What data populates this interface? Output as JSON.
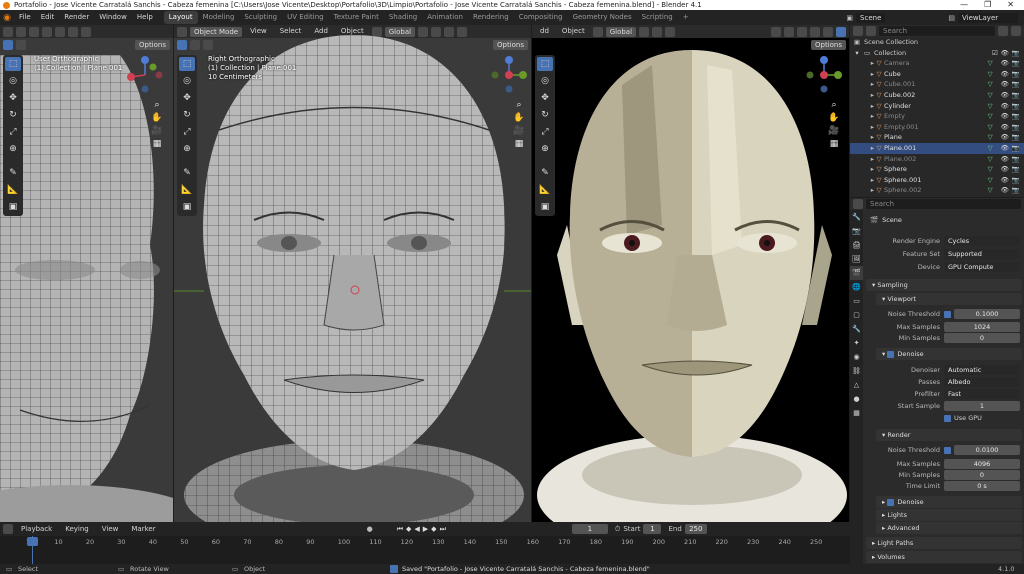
{
  "window": {
    "title": "Portafolio - Jose Vicente Carratalá Sanchis - Cabeza femenina [C:\\Users\\Jose Vicente\\Desktop\\Portafolio\\3D\\Limpio\\Portafolio - Jose Vicente Carratalá Sanchis - Cabeza femenina.blend] - Blender 4.1",
    "controls": [
      "—",
      "❐",
      "✕"
    ]
  },
  "menu": [
    "File",
    "Edit",
    "Render",
    "Window",
    "Help"
  ],
  "workspaces": [
    "Layout",
    "Modeling",
    "Sculpting",
    "UV Editing",
    "Texture Paint",
    "Shading",
    "Animation",
    "Rendering",
    "Compositing",
    "Geometry Nodes",
    "Scripting",
    "+"
  ],
  "scene_name": "Scene",
  "view_layer": "ViewLayer",
  "viewport_left": {
    "options": "Options",
    "view_name": "User Orthographic",
    "collection": "(1) Collection | Plane.001"
  },
  "viewport_mid": {
    "mode": "Object Mode",
    "menus": [
      "View",
      "Select",
      "Add",
      "Object"
    ],
    "transform": "Global",
    "options": "Options",
    "view_name": "Right Orthographic",
    "collection": "(1) Collection | Plane.001",
    "scale": "10 Centimeters"
  },
  "viewport_right": {
    "menus": [
      "dd",
      "Object"
    ],
    "transform": "Global",
    "options": "Options"
  },
  "outliner": {
    "search_placeholder": "Search",
    "root": "Scene Collection",
    "collection": "Collection",
    "items": [
      {
        "name": "Camera",
        "dim": true
      },
      {
        "name": "Cube",
        "dim": false
      },
      {
        "name": "Cube.001",
        "dim": true
      },
      {
        "name": "Cube.002",
        "dim": false
      },
      {
        "name": "Cylinder",
        "dim": false
      },
      {
        "name": "Empty",
        "dim": true
      },
      {
        "name": "Empty.001",
        "dim": true
      },
      {
        "name": "Plane",
        "dim": false
      },
      {
        "name": "Plane.001",
        "dim": false,
        "selected": true
      },
      {
        "name": "Plane.002",
        "dim": true
      },
      {
        "name": "Sphere",
        "dim": false
      },
      {
        "name": "Sphere.001",
        "dim": false
      },
      {
        "name": "Sphere.002",
        "dim": true
      }
    ]
  },
  "properties": {
    "search_placeholder": "Search",
    "context": "Scene",
    "render_engine_label": "Render Engine",
    "render_engine": "Cycles",
    "feature_set_label": "Feature Set",
    "feature_set": "Supported",
    "device_label": "Device",
    "device": "GPU Compute",
    "sampling": "Sampling",
    "viewport": "Viewport",
    "vp_noise_label": "Noise Threshold",
    "vp_noise": "0.1000",
    "vp_max_label": "Max Samples",
    "vp_max": "1024",
    "vp_min_label": "Min Samples",
    "vp_min": "0",
    "denoise": "Denoise",
    "denoiser_label": "Denoiser",
    "denoiser": "Automatic",
    "passes_label": "Passes",
    "passes": "Albedo",
    "prefilter_label": "Prefilter",
    "prefilter": "Fast",
    "start_sample_label": "Start Sample",
    "start_sample": "1",
    "use_gpu": "Use GPU",
    "render": "Render",
    "r_noise_label": "Noise Threshold",
    "r_noise": "0.0100",
    "r_max_label": "Max Samples",
    "r_max": "4096",
    "r_min_label": "Min Samples",
    "r_min": "0",
    "time_limit_label": "Time Limit",
    "time_limit": "0 s",
    "r_denoise": "Denoise",
    "lights": "Lights",
    "advanced": "Advanced",
    "light_paths": "Light Paths",
    "volumes": "Volumes"
  },
  "timeline": {
    "menus": [
      "Playback",
      "Keying",
      "View",
      "Marker"
    ],
    "current_frame": "1",
    "start_label": "Start",
    "start": "1",
    "end_label": "End",
    "end": "250",
    "ticks": [
      "1",
      "10",
      "20",
      "30",
      "40",
      "50",
      "60",
      "70",
      "80",
      "90",
      "100",
      "110",
      "120",
      "130",
      "140",
      "150",
      "160",
      "170",
      "180",
      "190",
      "200",
      "210",
      "220",
      "230",
      "240",
      "250"
    ]
  },
  "status": {
    "select": "Select",
    "rotate": "Rotate View",
    "object": "Object",
    "saved": "Saved \"Portafolio - Jose Vicente Carratalá Sanchis - Cabeza femenina.blend\"",
    "version": "4.1.0"
  },
  "colors": {
    "accent": "#4772b3",
    "selection": "#334d80",
    "orange": "#e87d0d"
  }
}
